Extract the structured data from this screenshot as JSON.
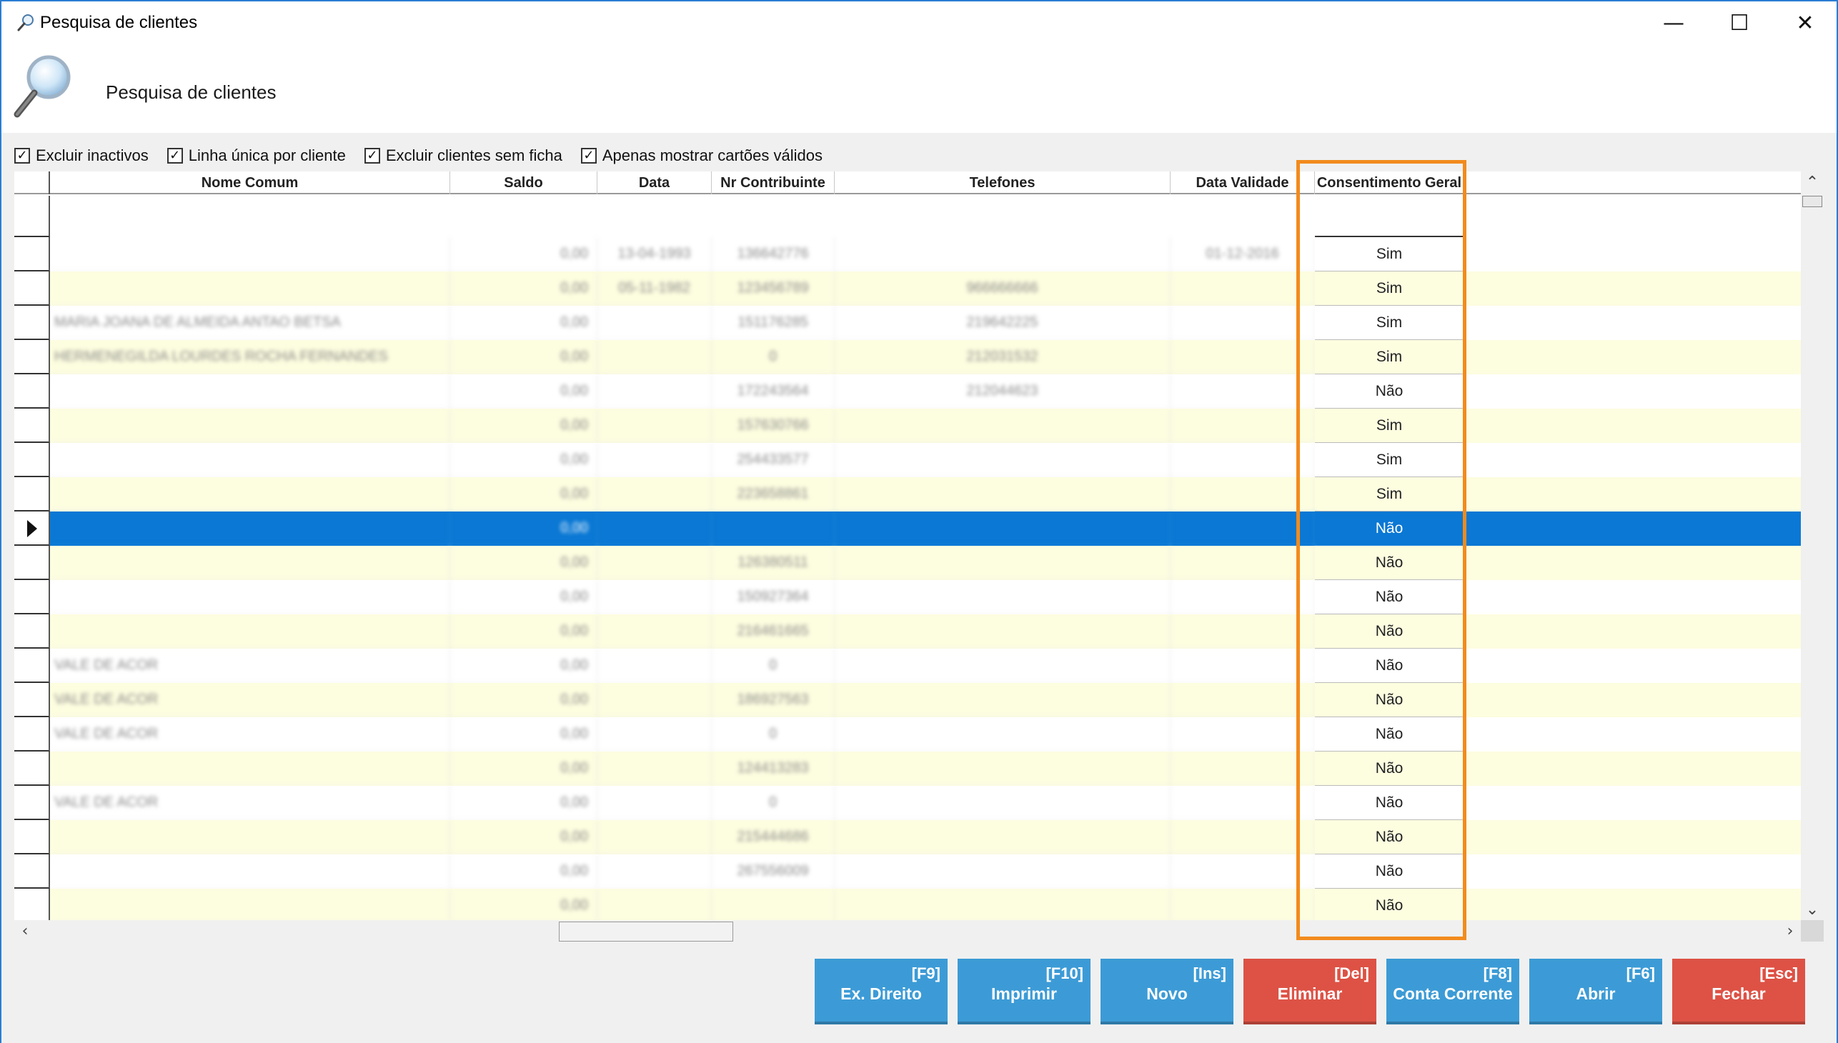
{
  "window": {
    "title": "Pesquisa de clientes",
    "minimize": "—",
    "maximize": "☐",
    "close": "✕"
  },
  "header": {
    "title": "Pesquisa de clientes"
  },
  "filters": [
    {
      "label": "Excluir inactivos",
      "checked": true
    },
    {
      "label": "Linha única por cliente",
      "checked": true
    },
    {
      "label": "Excluir clientes sem ficha",
      "checked": true
    },
    {
      "label": "Apenas mostrar cartões válidos",
      "checked": true
    }
  ],
  "grid": {
    "columns": [
      "Nome Comum",
      "Saldo",
      "Data",
      "Nr Contribuinte",
      "Telefones",
      "Data Validade",
      "Consentimento Geral"
    ],
    "rows": [
      {
        "nome": "",
        "saldo": "0,00",
        "data": "13-04-1993",
        "nif": "136642776",
        "tel": "",
        "validade": "01-12-2016",
        "consent": "Sim"
      },
      {
        "nome": "",
        "saldo": "0,00",
        "data": "05-11-1982",
        "nif": "123456789",
        "tel": "966666666",
        "validade": "",
        "consent": "Sim"
      },
      {
        "nome": "MARIA JOANA DE ALMEIDA ANTAO BETSA",
        "saldo": "0,00",
        "data": "",
        "nif": "151176285",
        "tel": "219642225",
        "validade": "",
        "consent": "Sim"
      },
      {
        "nome": "HERMENEGILDA LOURDES ROCHA FERNANDES",
        "saldo": "0,00",
        "data": "",
        "nif": "0",
        "tel": "212031532",
        "validade": "",
        "consent": "Sim"
      },
      {
        "nome": "",
        "saldo": "0,00",
        "data": "",
        "nif": "172243564",
        "tel": "212044623",
        "validade": "",
        "consent": "Não"
      },
      {
        "nome": "",
        "saldo": "0,00",
        "data": "",
        "nif": "157630766",
        "tel": "",
        "validade": "",
        "consent": "Sim"
      },
      {
        "nome": "",
        "saldo": "0,00",
        "data": "",
        "nif": "254433577",
        "tel": "",
        "validade": "",
        "consent": "Sim"
      },
      {
        "nome": "",
        "saldo": "0,00",
        "data": "",
        "nif": "223658861",
        "tel": "",
        "validade": "",
        "consent": "Sim"
      },
      {
        "nome": "",
        "saldo": "0,00",
        "data": "",
        "nif": "",
        "tel": "",
        "validade": "",
        "consent": "Não",
        "selected": true
      },
      {
        "nome": "",
        "saldo": "0,00",
        "data": "",
        "nif": "126380511",
        "tel": "",
        "validade": "",
        "consent": "Não"
      },
      {
        "nome": "",
        "saldo": "0,00",
        "data": "",
        "nif": "150927364",
        "tel": "",
        "validade": "",
        "consent": "Não"
      },
      {
        "nome": "",
        "saldo": "0,00",
        "data": "",
        "nif": "216461665",
        "tel": "",
        "validade": "",
        "consent": "Não"
      },
      {
        "nome": "VALE DE ACOR",
        "saldo": "0,00",
        "data": "",
        "nif": "0",
        "tel": "",
        "validade": "",
        "consent": "Não"
      },
      {
        "nome": "VALE DE ACOR",
        "saldo": "0,00",
        "data": "",
        "nif": "186927563",
        "tel": "",
        "validade": "",
        "consent": "Não"
      },
      {
        "nome": "VALE DE ACOR",
        "saldo": "0,00",
        "data": "",
        "nif": "0",
        "tel": "",
        "validade": "",
        "consent": "Não"
      },
      {
        "nome": "",
        "saldo": "0,00",
        "data": "",
        "nif": "124413283",
        "tel": "",
        "validade": "",
        "consent": "Não"
      },
      {
        "nome": "VALE DE ACOR",
        "saldo": "0,00",
        "data": "",
        "nif": "0",
        "tel": "",
        "validade": "",
        "consent": "Não"
      },
      {
        "nome": "",
        "saldo": "0,00",
        "data": "",
        "nif": "215444686",
        "tel": "",
        "validade": "",
        "consent": "Não"
      },
      {
        "nome": "",
        "saldo": "0,00",
        "data": "",
        "nif": "267556009",
        "tel": "",
        "validade": "",
        "consent": "Não"
      },
      {
        "nome": "",
        "saldo": "0,00",
        "data": "",
        "nif": "",
        "tel": "",
        "validade": "",
        "consent": "Não"
      }
    ]
  },
  "buttons": [
    {
      "key": "[F9]",
      "label": "Ex. Direito",
      "color": "#3c9bd6"
    },
    {
      "key": "[F10]",
      "label": "Imprimir",
      "color": "#3c9bd6"
    },
    {
      "key": "[Ins]",
      "label": "Novo",
      "color": "#3c9bd6"
    },
    {
      "key": "[Del]",
      "label": "Eliminar",
      "color": "#dd5245"
    },
    {
      "key": "[F8]",
      "label": "Conta Corrente",
      "color": "#3c9bd6"
    },
    {
      "key": "[F6]",
      "label": "Abrir",
      "color": "#3c9bd6"
    },
    {
      "key": "[Esc]",
      "label": "Fechar",
      "color": "#dd5245"
    }
  ],
  "colors": {
    "selection": "#0a78d4",
    "row_alt": "#fdfde0",
    "highlight": "#f28b1d"
  }
}
